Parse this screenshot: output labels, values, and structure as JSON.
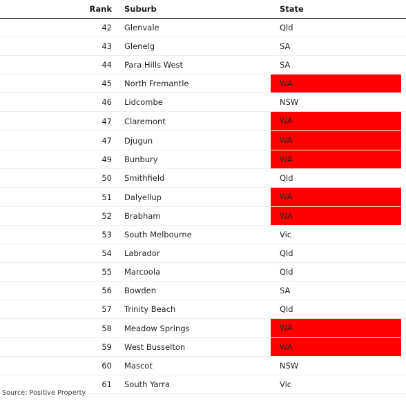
{
  "table": {
    "columns": [
      {
        "key": "rank",
        "label": "Rank"
      },
      {
        "key": "suburb",
        "label": "Suburb"
      },
      {
        "key": "state",
        "label": "State"
      }
    ],
    "highlight_color": "#ff0000",
    "highlight_state": "WA",
    "rows": [
      {
        "rank": "42",
        "suburb": "Glenvale",
        "state": "Qld",
        "highlighted": false
      },
      {
        "rank": "43",
        "suburb": "Glenelg",
        "state": "SA",
        "highlighted": false
      },
      {
        "rank": "44",
        "suburb": "Para Hills West",
        "state": "SA",
        "highlighted": false
      },
      {
        "rank": "45",
        "suburb": "North Fremantle",
        "state": "WA",
        "highlighted": true
      },
      {
        "rank": "46",
        "suburb": "Lidcombe",
        "state": "NSW",
        "highlighted": false
      },
      {
        "rank": "47",
        "suburb": "Claremont",
        "state": "WA",
        "highlighted": true
      },
      {
        "rank": "47",
        "suburb": "Djugun",
        "state": "WA",
        "highlighted": true
      },
      {
        "rank": "49",
        "suburb": "Bunbury",
        "state": "WA",
        "highlighted": true
      },
      {
        "rank": "50",
        "suburb": "Smithfield",
        "state": "Qld",
        "highlighted": false
      },
      {
        "rank": "51",
        "suburb": "Dalyellup",
        "state": "WA",
        "highlighted": true
      },
      {
        "rank": "52",
        "suburb": "Brabham",
        "state": "WA",
        "highlighted": true
      },
      {
        "rank": "53",
        "suburb": "South Melbourne",
        "state": "Vic",
        "highlighted": false
      },
      {
        "rank": "54",
        "suburb": "Labrador",
        "state": "Qld",
        "highlighted": false
      },
      {
        "rank": "55",
        "suburb": "Marcoola",
        "state": "Qld",
        "highlighted": false
      },
      {
        "rank": "56",
        "suburb": "Bowden",
        "state": "SA",
        "highlighted": false
      },
      {
        "rank": "57",
        "suburb": "Trinity Beach",
        "state": "Qld",
        "highlighted": false
      },
      {
        "rank": "58",
        "suburb": "Meadow Springs",
        "state": "WA",
        "highlighted": true
      },
      {
        "rank": "59",
        "suburb": "West Busselton",
        "state": "WA",
        "highlighted": true
      },
      {
        "rank": "60",
        "suburb": "Mascot",
        "state": "NSW",
        "highlighted": false
      },
      {
        "rank": "61",
        "suburb": "South Yarra",
        "state": "Vic",
        "highlighted": false
      }
    ]
  },
  "footer": {
    "source": "Source: Positive Property"
  }
}
